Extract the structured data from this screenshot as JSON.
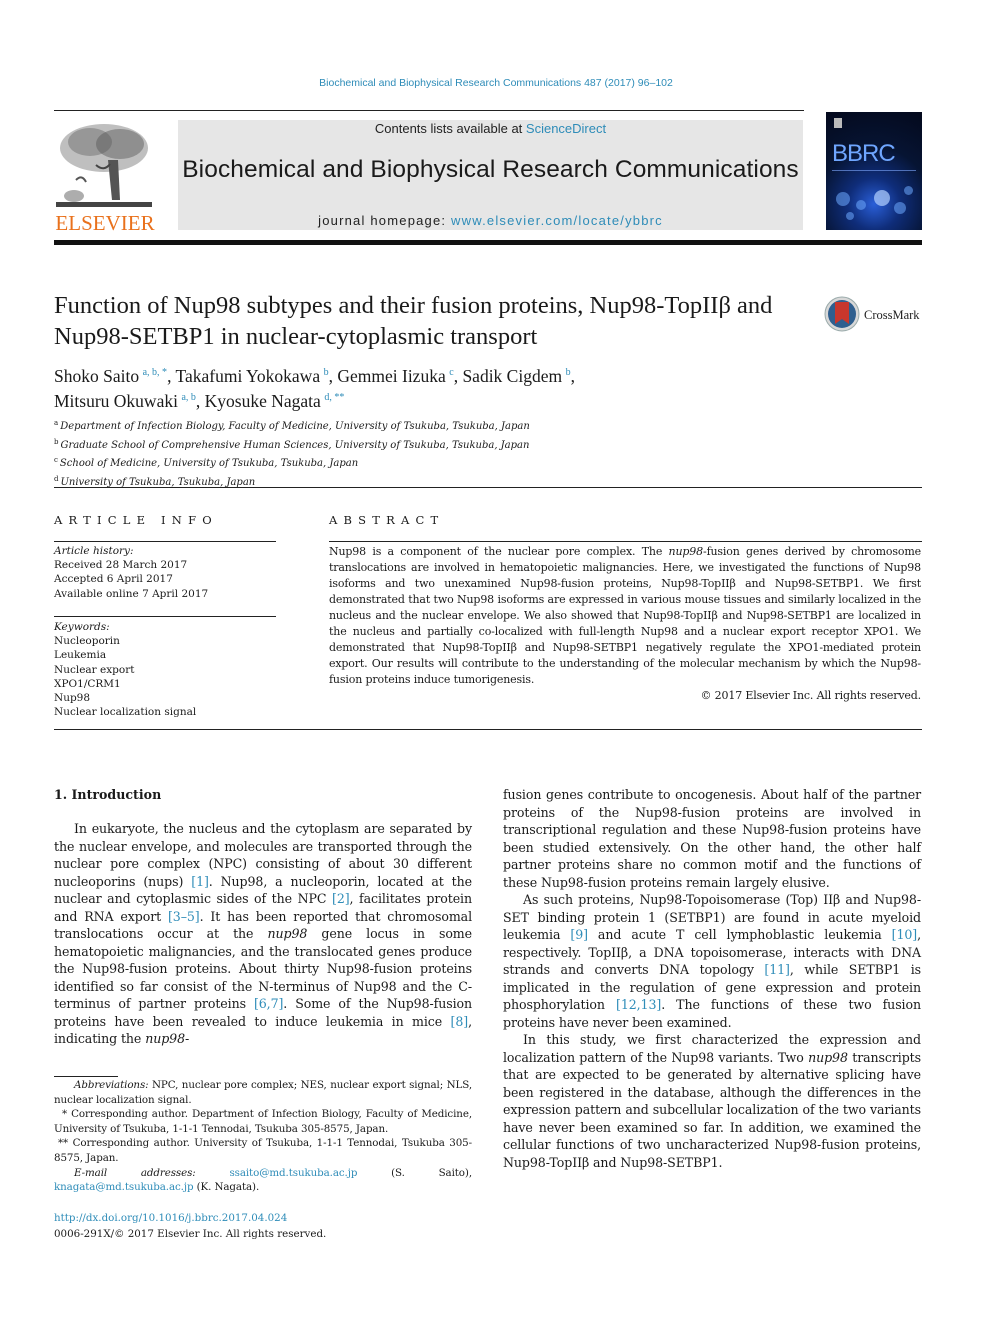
{
  "running_header": "Biochemical and Biophysical Research Communications 487 (2017) 96–102",
  "publisher": {
    "logo_text": "ELSEVIER",
    "logo_color": "#e9711c"
  },
  "banner": {
    "contents_prefix": "Contents lists available at ",
    "contents_link": "ScienceDirect",
    "journal_title": "Biochemical and Biophysical Research Communications",
    "homepage_prefix": "journal homepage: ",
    "homepage_link": "www.elsevier.com/locate/ybbrc"
  },
  "cover": {
    "title": "BBRC"
  },
  "article": {
    "title": "Function of Nup98 subtypes and their fusion proteins, Nup98-TopIIβ and Nup98-SETBP1 in nuclear-cytoplasmic transport",
    "crossmark_label": "CrossMark",
    "authors": [
      {
        "name": "Shoko Saito",
        "sup": "a, b, *",
        "sep": ", "
      },
      {
        "name": "Takafumi Yokokawa",
        "sup": "b",
        "sep": ", "
      },
      {
        "name": "Gemmei Iizuka",
        "sup": "c",
        "sep": ", "
      },
      {
        "name": "Sadik Cigdem",
        "sup": "b",
        "sep": ","
      },
      {
        "name": "Mitsuru Okuwaki",
        "sup": "a, b",
        "sep": ", "
      },
      {
        "name": "Kyosuke Nagata",
        "sup": "d, **",
        "sep": ""
      }
    ],
    "affiliations": [
      {
        "key": "a",
        "text": "Department of Infection Biology, Faculty of Medicine, University of Tsukuba, Tsukuba, Japan"
      },
      {
        "key": "b",
        "text": "Graduate School of Comprehensive Human Sciences, University of Tsukuba, Tsukuba, Japan"
      },
      {
        "key": "c",
        "text": "School of Medicine, University of Tsukuba, Tsukuba, Japan"
      },
      {
        "key": "d",
        "text": "University of Tsukuba, Tsukuba, Japan"
      }
    ]
  },
  "article_info": {
    "heading": "ARTICLE INFO",
    "history_label": "Article history:",
    "history": [
      "Received 28 March 2017",
      "Accepted 6 April 2017",
      "Available online 7 April 2017"
    ],
    "keywords_label": "Keywords:",
    "keywords": [
      "Nucleoporin",
      "Leukemia",
      "Nuclear export",
      "XPO1/CRM1",
      "Nup98",
      "Nuclear localization signal"
    ]
  },
  "abstract": {
    "heading": "ABSTRACT",
    "p1": "Nup98 is a component of the nuclear pore complex. The ",
    "p1_italic": "nup98",
    "p2": "-fusion genes derived by chromosome translocations are involved in hematopoietic malignancies. Here, we investigated the functions of Nup98 isoforms and two unexamined Nup98-fusion proteins, Nup98-TopIIβ and Nup98-SETBP1. We first demonstrated that two Nup98 isoforms are expressed in various mouse tissues and similarly localized in the nucleus and the nuclear envelope. We also showed that Nup98-TopIIβ and Nup98-SETBP1 are localized in the nucleus and partially co-localized with full-length Nup98 and a nuclear export receptor XPO1. We demonstrated that Nup98-TopIIβ and Nup98-SETBP1 negatively regulate the XPO1-mediated protein export. Our results will contribute to the understanding of the molecular mechanism by which the Nup98-fusion proteins induce tumorigenesis.",
    "copyright": "© 2017 Elsevier Inc. All rights reserved."
  },
  "body": {
    "section_heading": "1.  Introduction",
    "left": [
      {
        "t": "In eukaryote, the nucleus and the cytoplasm are separated by the nuclear envelope, and molecules are transported through the nuclear pore complex (NPC) consisting of about 30 different nucleoporins (nups) "
      },
      {
        "r": "[1]"
      },
      {
        "t": ". Nup98, a nucleoporin, located at the nuclear and cytoplasmic sides of the NPC "
      },
      {
        "r": "[2]"
      },
      {
        "t": ", facilitates protein and RNA export "
      },
      {
        "r": "[3–5]"
      },
      {
        "t": ". It has been reported that chromosomal translocations occur at the "
      },
      {
        "i": "nup98"
      },
      {
        "t": " gene locus in some hematopoietic malignancies, and the translocated genes produce the Nup98-fusion proteins. About thirty Nup98-fusion proteins identified so far consist of the N-terminus of Nup98 and the C-terminus of partner proteins "
      },
      {
        "r": "[6,7]"
      },
      {
        "t": ". Some of the Nup98-fusion proteins have been revealed to induce leukemia in mice "
      },
      {
        "r": "[8]"
      },
      {
        "t": ", indicating the "
      },
      {
        "i": "nup98"
      },
      {
        "t": "-"
      }
    ],
    "right_p1": [
      {
        "t": "fusion genes contribute to oncogenesis. About half of the partner proteins of the Nup98-fusion proteins are involved in transcriptional regulation and these Nup98-fusion proteins have been studied extensively. On the other hand, the other half partner proteins share no common motif and the functions of these Nup98-fusion proteins remain largely elusive."
      }
    ],
    "right_p2": [
      {
        "t": "As such proteins, Nup98-Topoisomerase (Top) IIβ and Nup98-SET binding protein 1 (SETBP1) are found in acute myeloid leukemia "
      },
      {
        "r": "[9]"
      },
      {
        "t": " and acute T cell lymphoblastic leukemia "
      },
      {
        "r": "[10]"
      },
      {
        "t": ", respectively. TopIIβ, a DNA topoisomerase, interacts with DNA strands and converts DNA topology "
      },
      {
        "r": "[11]"
      },
      {
        "t": ", while SETBP1 is implicated in the regulation of gene expression and protein phosphorylation "
      },
      {
        "r": "[12,13]"
      },
      {
        "t": ". The functions of these two fusion proteins have never been examined."
      }
    ],
    "right_p3": [
      {
        "t": "In this study, we first characterized the expression and localization pattern of the Nup98 variants. Two "
      },
      {
        "i": "nup98"
      },
      {
        "t": " transcripts that are expected to be generated by alternative splicing have been registered in the database, although the differences in the expression pattern and subcellular localization of the two variants have never been examined so far. In addition, we examined the cellular functions of two uncharacterized Nup98-fusion proteins, Nup98-TopIIβ and Nup98-SETBP1."
      }
    ]
  },
  "footnotes": {
    "abbrev_label": "Abbreviations:",
    "abbrev_text": " NPC, nuclear pore complex; NES, nuclear export signal; NLS, nuclear localization signal.",
    "corr1": "* Corresponding author. Department of Infection Biology, Faculty of Medicine, University of Tsukuba, 1-1-1 Tennodai, Tsukuba 305-8575, Japan.",
    "corr2": "** Corresponding author. University of Tsukuba, 1-1-1 Tennodai, Tsukuba 305-8575, Japan.",
    "email_label": "E-mail addresses:",
    "email1": "ssaito@md.tsukuba.ac.jp",
    "email1_who": " (S. Saito), ",
    "email2": "knagata@md.tsukuba.ac.jp",
    "email2_who": " (K. Nagata).",
    "doi": "http://dx.doi.org/10.1016/j.bbrc.2017.04.024",
    "issn": "0006-291X/© 2017 Elsevier Inc. All rights reserved."
  },
  "colors": {
    "link": "#2e8cb8",
    "banner_bg": "#e6e6e6",
    "elsevier_orange": "#e9711c"
  }
}
